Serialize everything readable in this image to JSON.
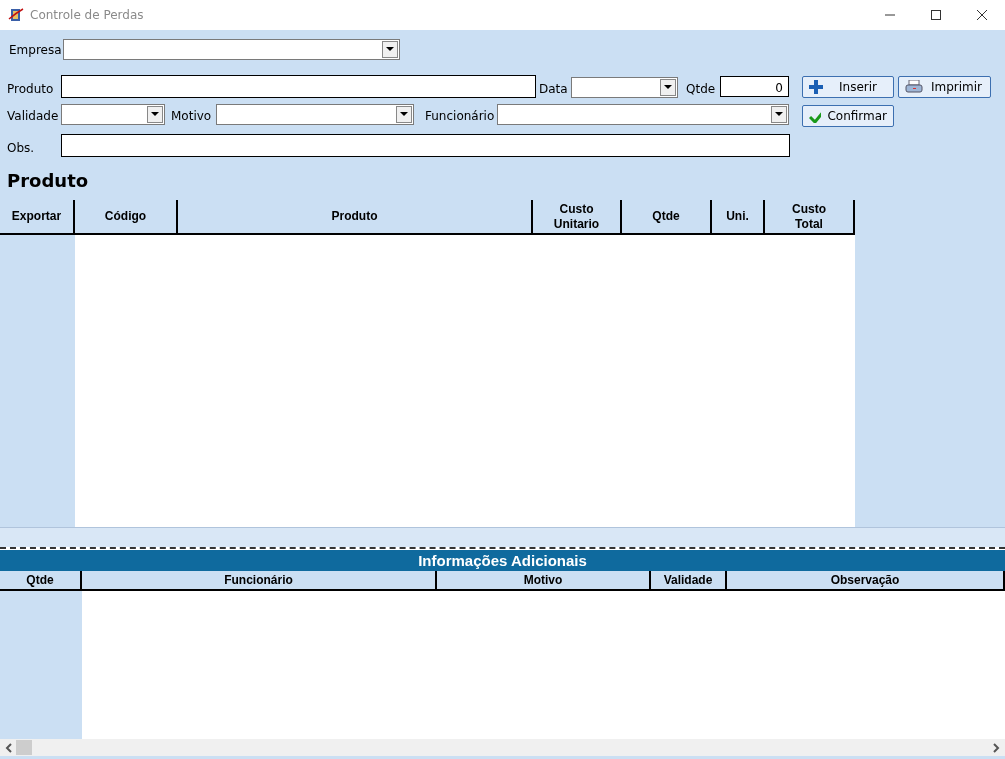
{
  "window": {
    "title": "Controle de Perdas"
  },
  "form": {
    "empresa": {
      "label": "Empresa"
    },
    "produto": {
      "label": "Produto"
    },
    "data": {
      "label": "Data"
    },
    "qtde": {
      "label": "Qtde",
      "value": "0"
    },
    "validade": {
      "label": "Validade"
    },
    "motivo": {
      "label": "Motivo"
    },
    "funcionario": {
      "label": "Funcionário"
    },
    "obs": {
      "label": "Obs."
    }
  },
  "buttons": [
    {
      "label": "Inserir",
      "kind": "plus"
    },
    {
      "label": "Imprimir",
      "kind": "printer"
    },
    {
      "label": "Confirmar",
      "kind": "check"
    }
  ],
  "products": {
    "title": "Produto",
    "columns": [
      "Exportar",
      "Código",
      "Produto",
      "Custo Unitario",
      "Qtde",
      "Uni.",
      "Custo Total"
    ]
  },
  "info": {
    "title": "Informações Adicionais",
    "columns": [
      "Qtde",
      "Funcionário",
      "Motivo",
      "Validade",
      "Observação"
    ]
  }
}
